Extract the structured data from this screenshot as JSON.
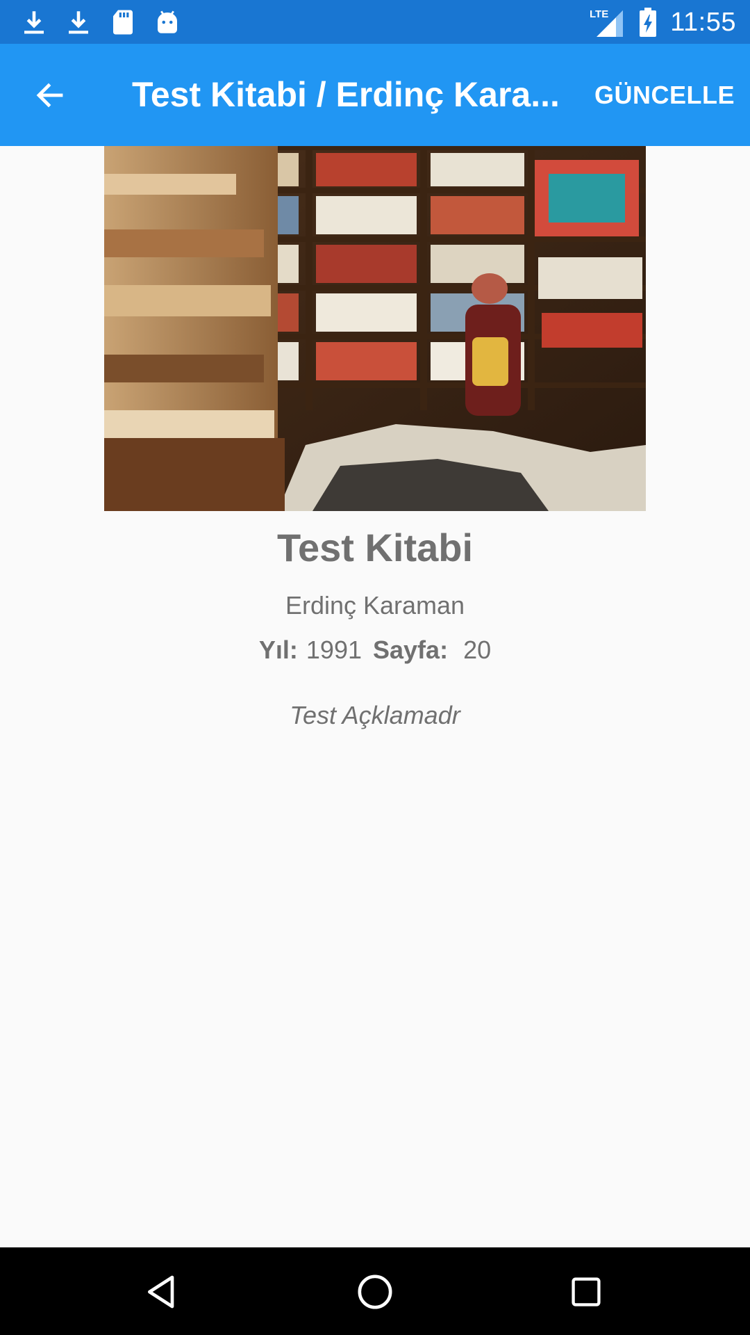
{
  "status_bar": {
    "icons_left": [
      "download-icon",
      "download-icon",
      "sd-card-icon",
      "android-icon"
    ],
    "network": "LTE",
    "time": "11:55"
  },
  "app_bar": {
    "title": "Test Kitabi / Erdinç Kara...",
    "action_label": "GÜNCELLE"
  },
  "book": {
    "title": "Test Kitabi",
    "author": "Erdinç Karaman",
    "year_label": "Yıl:",
    "year": "1991",
    "pages_label": "Sayfa:",
    "pages": "20",
    "description": "Test Açklamadr"
  },
  "nav_bar": {
    "buttons": [
      "back-triangle-icon",
      "home-circle-icon",
      "recents-square-icon"
    ]
  },
  "colors": {
    "status_bar": "#1976d2",
    "app_bar": "#2196f3",
    "text": "#707070",
    "background": "#fafafa"
  }
}
